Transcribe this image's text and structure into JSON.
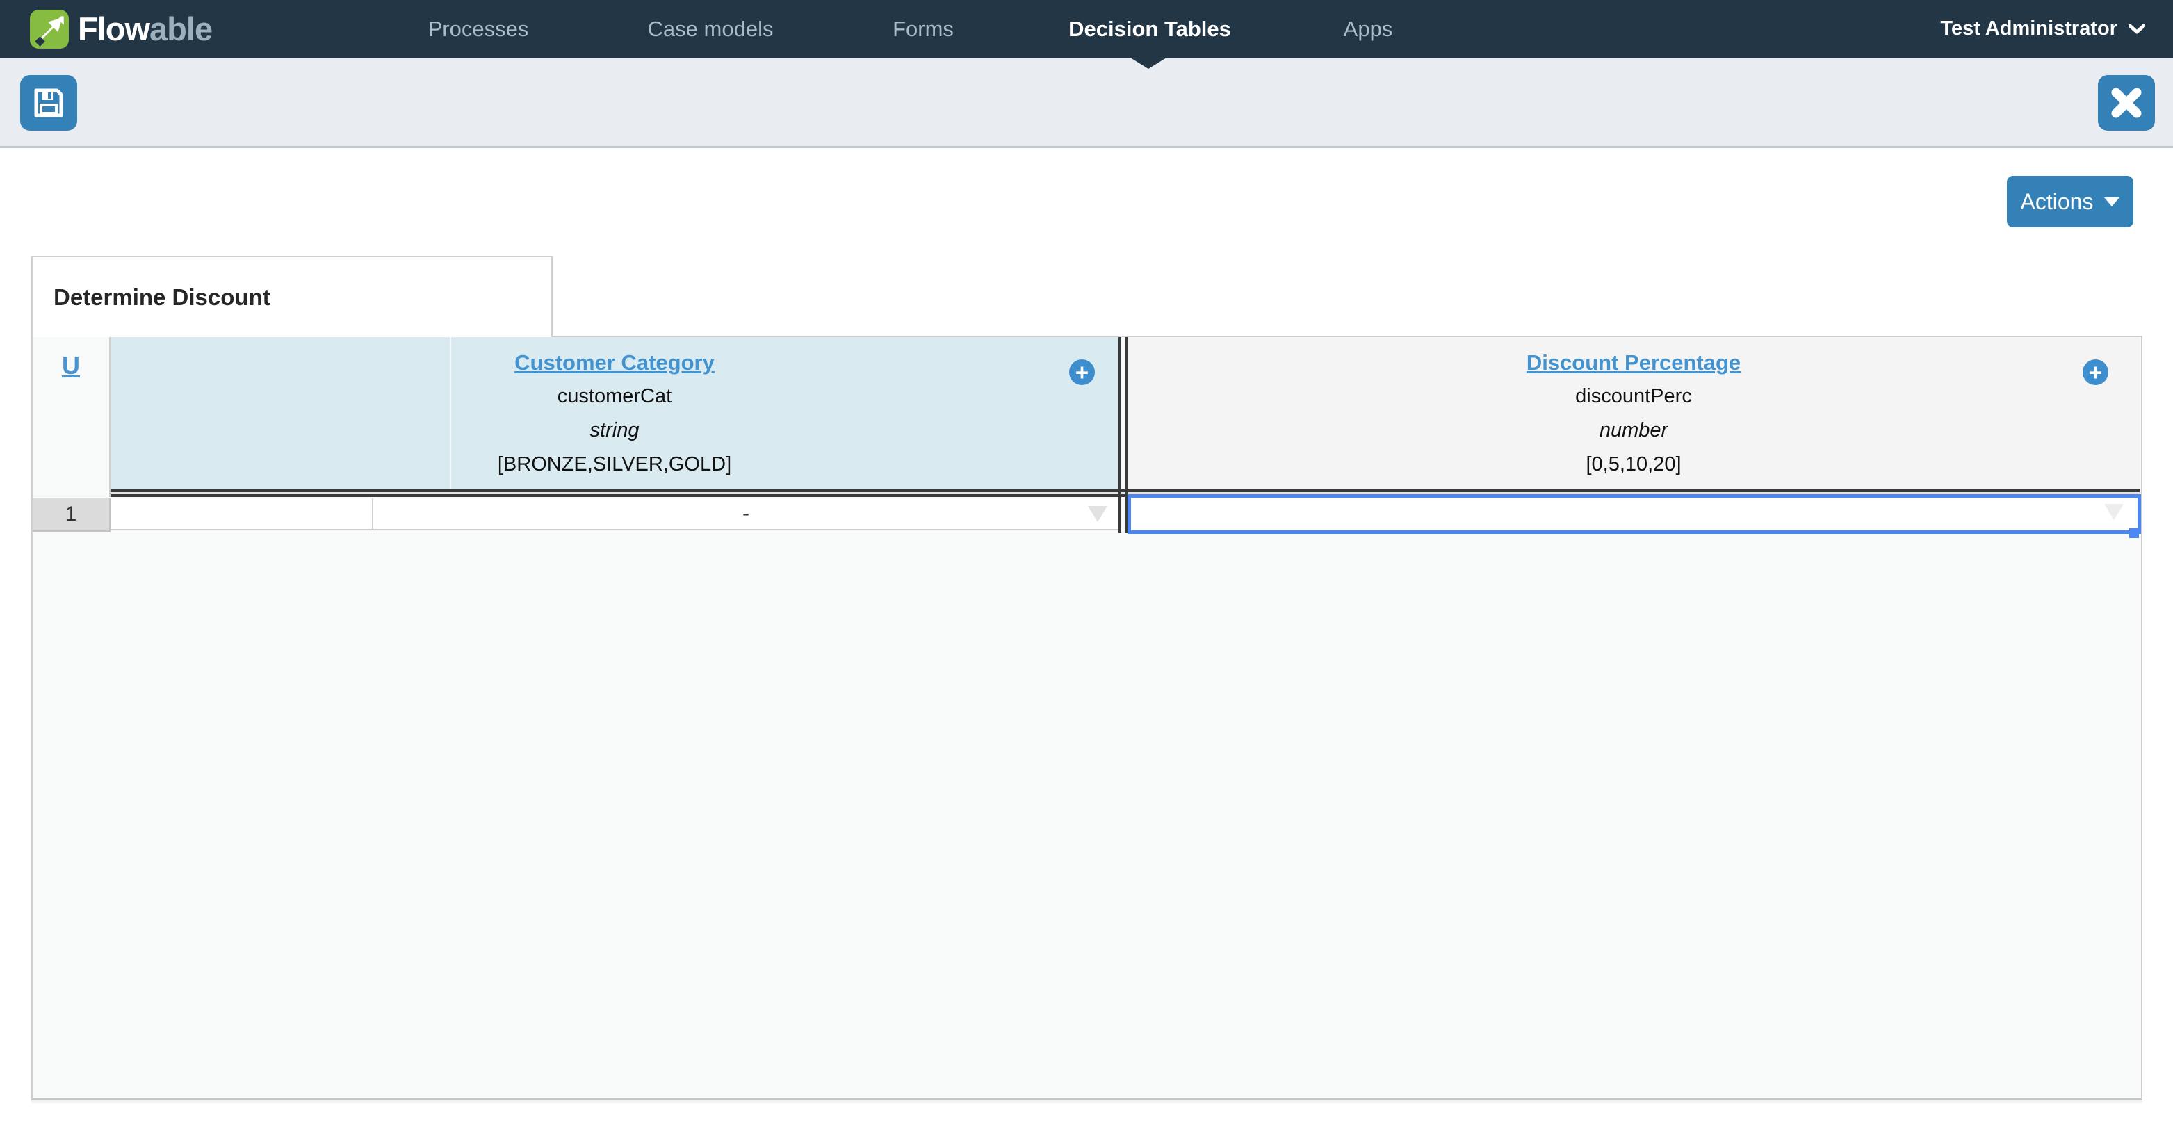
{
  "navbar": {
    "logo": {
      "text_primary": "Flow",
      "text_secondary": "able",
      "icon": "flowable-arrow-icon"
    },
    "items": [
      {
        "label": "Processes",
        "active": false
      },
      {
        "label": "Case models",
        "active": false
      },
      {
        "label": "Forms",
        "active": false
      },
      {
        "label": "Decision Tables",
        "active": true
      },
      {
        "label": "Apps",
        "active": false
      }
    ],
    "user": {
      "name": "Test Administrator",
      "icon": "chevron-down-icon"
    }
  },
  "toolbar": {
    "save_button": {
      "icon": "floppy-disk-icon"
    },
    "close_button": {
      "icon": "close-x-icon"
    }
  },
  "page": {
    "actions_button": {
      "label": "Actions",
      "icon": "caret-down-icon"
    }
  },
  "decision_table": {
    "title": "Determine Discount",
    "hit_policy": "U",
    "inputs": [
      {
        "label": "Customer Category",
        "variable": "customerCat",
        "type": "string",
        "allowed_values": "[BRONZE,SILVER,GOLD]",
        "add_icon": "plus-circle-icon"
      }
    ],
    "outputs": [
      {
        "label": "Discount Percentage",
        "variable": "discountPerc",
        "type": "number",
        "allowed_values": "[0,5,10,20]",
        "add_icon": "plus-circle-icon"
      }
    ],
    "rows": [
      {
        "number": "1",
        "cells": {
          "input_extra": "",
          "input_condition": "-",
          "output_conclusion": ""
        }
      }
    ]
  },
  "colors": {
    "navbar_bg": "#233646",
    "accent_blue": "#3481b8",
    "link_blue": "#4293d0",
    "input_header_bg": "#d9eaf1",
    "output_header_bg": "#f4f4f4",
    "selection_blue": "#4c87f2",
    "logo_green": "#86bd40"
  }
}
